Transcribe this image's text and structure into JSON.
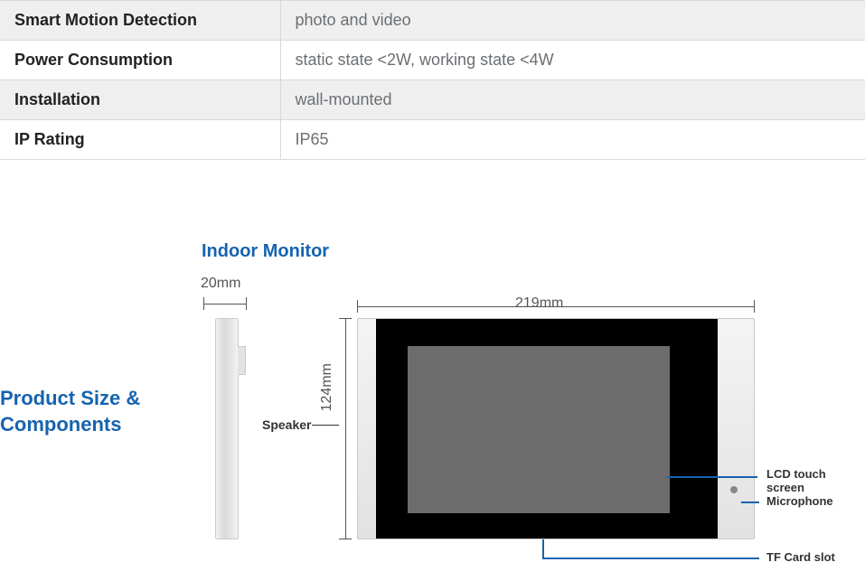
{
  "specs": [
    {
      "label": "Smart Motion Detection",
      "value": "photo and video",
      "shaded": true
    },
    {
      "label": "Power Consumption",
      "value": "static state <2W, working state <4W",
      "shaded": false
    },
    {
      "label": "Installation",
      "value": "wall-mounted",
      "shaded": true
    },
    {
      "label": "IP Rating",
      "value": "IP65",
      "shaded": false
    }
  ],
  "section_title_line1": "Product Size &",
  "section_title_line2": "Components",
  "subsection_title": "Indoor Monitor",
  "dimensions": {
    "depth": "20mm",
    "width": "219mm",
    "height": "124mm"
  },
  "labels": {
    "speaker": "Speaker",
    "lcd": "LCD touch screen",
    "mic": "Microphone",
    "tf": "TF Card slot"
  }
}
